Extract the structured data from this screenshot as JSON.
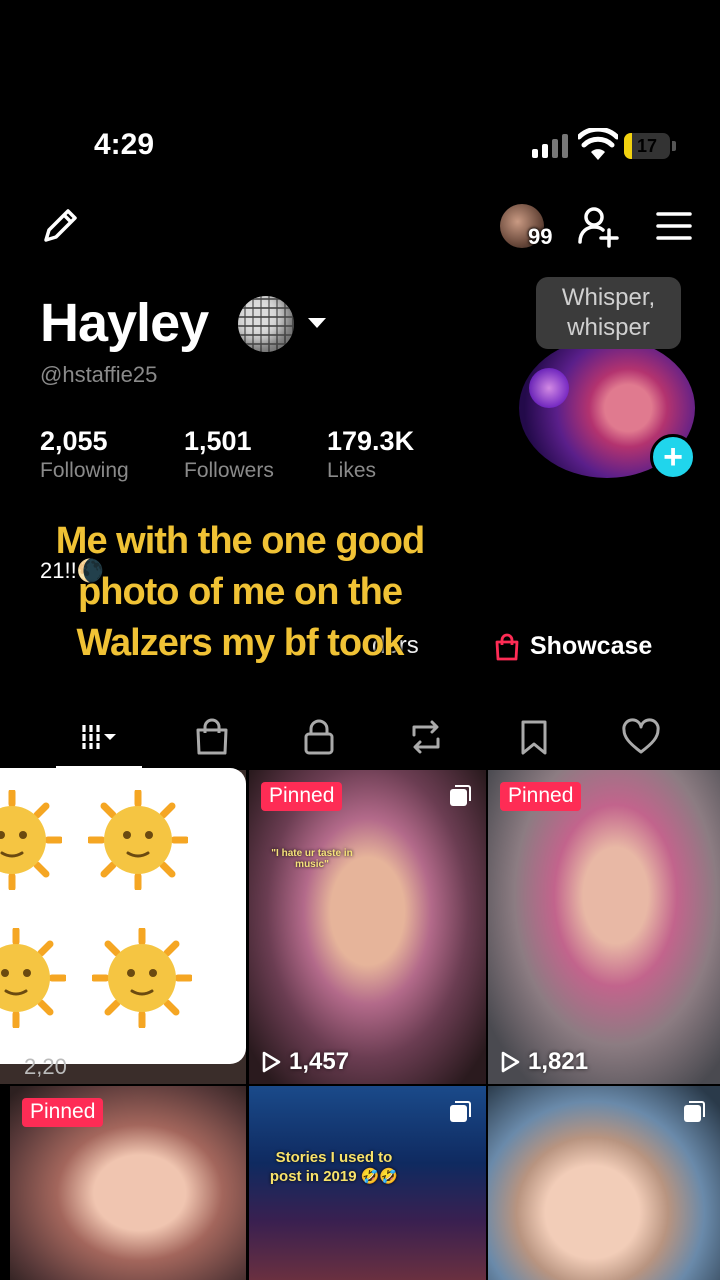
{
  "status_bar": {
    "time": "4:29",
    "battery": "17"
  },
  "header": {
    "notification_count": "99"
  },
  "profile": {
    "name": "Hayley",
    "username": "@hstaffie25",
    "tooltip": "Whisper, whisper",
    "stats": [
      {
        "value": "2,055",
        "label": "Following"
      },
      {
        "value": "1,501",
        "label": "Followers"
      },
      {
        "value": "179.3K",
        "label": "Likes"
      }
    ],
    "bio_line1": "21!!🌘",
    "links_text": "ders",
    "showcase_label": "Showcase"
  },
  "overlay_caption": "Me with the one good photo of me on the Walzers my bf took",
  "tabs": [
    "videos",
    "shop",
    "private",
    "reposts",
    "saved",
    "liked"
  ],
  "sticker": {
    "peek_text": "2,20"
  },
  "videos": [
    {
      "pinned": "Pinned",
      "views": "1,457",
      "caption": "\"I hate ur taste in music\""
    },
    {
      "pinned": "Pinned",
      "views": "1,821"
    },
    {
      "pinned": "Pinned"
    },
    {
      "caption": "Stories I used to post in 2019 🤣🤣"
    },
    {}
  ],
  "colors": {
    "accent": "#fe2c55",
    "add_button": "#20d5ec",
    "caption": "#f0c235"
  }
}
